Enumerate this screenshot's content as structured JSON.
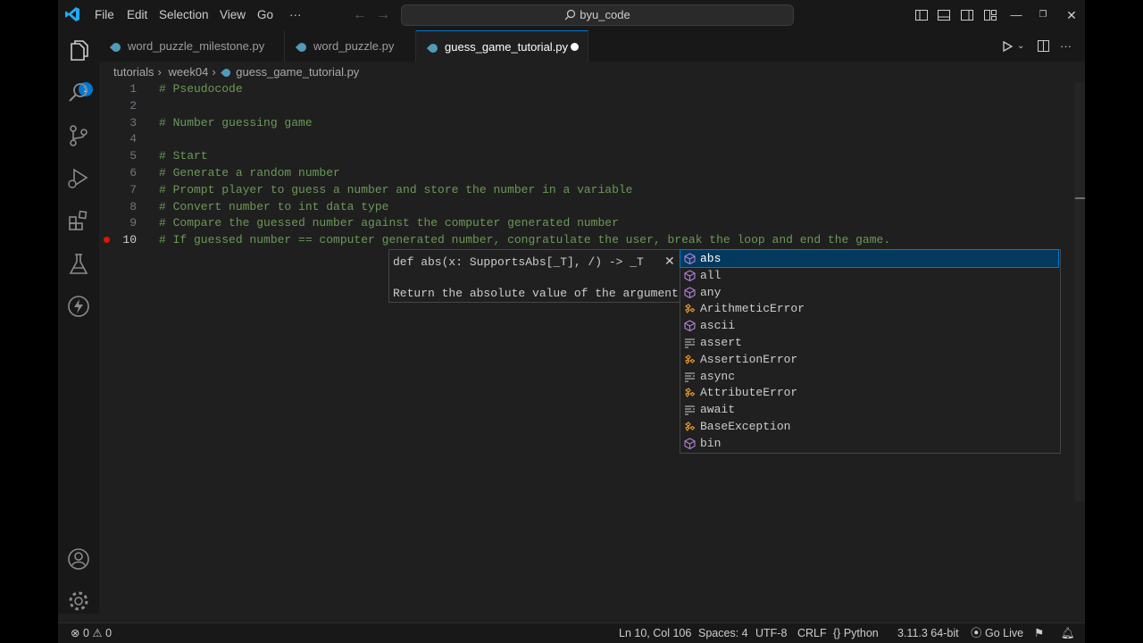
{
  "titlebar": {
    "menus": [
      "File",
      "Edit",
      "Selection",
      "View",
      "Go",
      "···"
    ],
    "search_text": "byu_code"
  },
  "activity": {
    "explorer_badge": "1"
  },
  "tabs": [
    {
      "label": "word_puzzle_milestone.py"
    },
    {
      "label": "word_puzzle.py"
    },
    {
      "label": "guess_game_tutorial.py"
    }
  ],
  "breadcrumb": [
    "tutorials",
    "week04",
    "guess_game_tutorial.py"
  ],
  "editor": {
    "lines": [
      {
        "num": "1",
        "text": "# Pseudocode"
      },
      {
        "num": "2",
        "text": ""
      },
      {
        "num": "3",
        "text": "# Number guessing game"
      },
      {
        "num": "4",
        "text": ""
      },
      {
        "num": "5",
        "text": "# Start"
      },
      {
        "num": "6",
        "text": "# Generate a random number"
      },
      {
        "num": "7",
        "text": "# Prompt player to guess a number and store the number in a variable"
      },
      {
        "num": "8",
        "text": "# Convert number to int data type"
      },
      {
        "num": "9",
        "text": "# Compare the guessed number against the computer generated number"
      },
      {
        "num": "10",
        "text": "# If guessed number == computer generated number, congratulate the user, break the loop and end the game."
      }
    ]
  },
  "hover": {
    "signature": "def abs(x: SupportsAbs[_T], /) -> _T",
    "doc": "Return the absolute value of the argument."
  },
  "suggestions": [
    {
      "label": "abs",
      "kind": "function"
    },
    {
      "label": "all",
      "kind": "function"
    },
    {
      "label": "any",
      "kind": "function"
    },
    {
      "label": "ArithmeticError",
      "kind": "class"
    },
    {
      "label": "ascii",
      "kind": "function"
    },
    {
      "label": "assert",
      "kind": "keyword"
    },
    {
      "label": "AssertionError",
      "kind": "class"
    },
    {
      "label": "async",
      "kind": "keyword"
    },
    {
      "label": "AttributeError",
      "kind": "class"
    },
    {
      "label": "await",
      "kind": "keyword"
    },
    {
      "label": "BaseException",
      "kind": "class"
    },
    {
      "label": "bin",
      "kind": "function"
    }
  ],
  "statusbar": {
    "errors": "0",
    "warnings": "0",
    "position": "Ln 10, Col 106",
    "spaces": "Spaces: 4",
    "encoding": "UTF-8",
    "eol": "CRLF",
    "language": "Python",
    "interpreter": "3.11.3 64-bit",
    "golive": "Go Live"
  },
  "colors": {
    "accent": "#0078d4",
    "comment": "#6a9955",
    "breakpoint": "#e51400"
  }
}
